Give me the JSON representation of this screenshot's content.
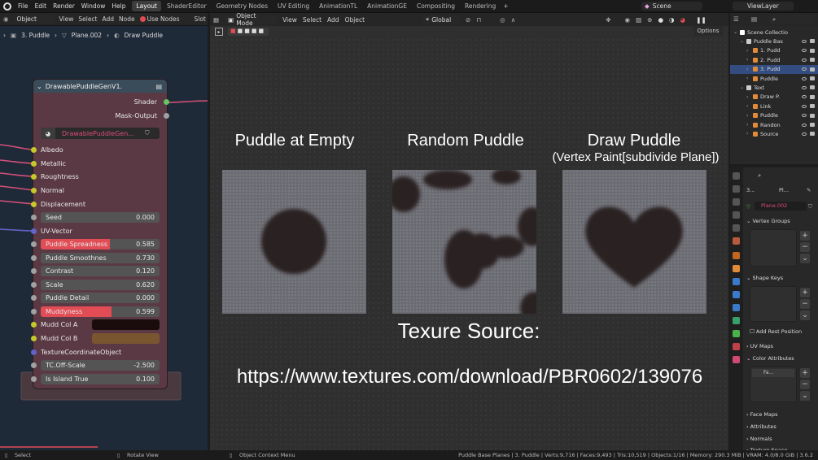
{
  "topbar": {
    "menus": [
      "File",
      "Edit",
      "Render",
      "Window",
      "Help"
    ],
    "workspaces": [
      "Layout",
      "ShaderEditor",
      "Geometry Nodes",
      "UV Editing",
      "AnimationTL",
      "AnimationGE",
      "Compositing",
      "Rendering"
    ],
    "active_workspace": "Layout",
    "scene": "Scene",
    "view_layer": "ViewLayer"
  },
  "node_header": {
    "mode": "Object",
    "menus": [
      "View",
      "Select",
      "Add",
      "Node"
    ],
    "use_nodes": "Use Nodes",
    "slot": "Slot"
  },
  "breadcrumb": [
    "3. Puddle",
    "Plane.002",
    "Draw Puddle"
  ],
  "node": {
    "title": "DrawablePuddleGenV1.",
    "outputs": [
      "Shader",
      "Mask-Output"
    ],
    "group_name": "DrawablePuddleGen...",
    "inputs": [
      "Albedo",
      "Metallic",
      "Roughtness",
      "Normal",
      "Displacement"
    ],
    "seed": {
      "label": "Seed",
      "value": "0.000"
    },
    "uv": "UV-Vector",
    "sliders": [
      {
        "label": "Puddle Spreadness",
        "value": "0.585",
        "fill": 0.585
      },
      {
        "label": "Puddle Smoothnes",
        "value": "0.730",
        "fill": 0
      },
      {
        "label": "Contrast",
        "value": "0.120",
        "fill": 0
      },
      {
        "label": "Scale",
        "value": "0.620",
        "fill": 0
      },
      {
        "label": "Puddle Detail",
        "value": "0.000",
        "fill": 0
      },
      {
        "label": "Muddyness",
        "value": "0.599",
        "fill": 0.599
      }
    ],
    "color_a": {
      "label": "Mudd Col A",
      "color": "#1a0c0c"
    },
    "color_b": {
      "label": "Mudd Col B",
      "color": "#7a5630"
    },
    "texcoord": "TextureCoordinateObject",
    "tc_offscale": {
      "label": "TC.Off-Scale",
      "value": "-2.500"
    },
    "island": {
      "label": "Is Island True",
      "value": "0.100"
    }
  },
  "viewport_header": {
    "mode": "Object Mode",
    "menus": [
      "View",
      "Select",
      "Add",
      "Object"
    ],
    "orientation": "Global",
    "options": "Options"
  },
  "captions": {
    "empty": "Puddle at Empty",
    "random": "Random Puddle",
    "draw": "Draw Puddle",
    "draw_sub": "(Vertex Paint[subdivide Plane])",
    "source_label": "Texure Source:",
    "url": "https://www.textures.com/download/PBR0602/139076"
  },
  "outliner": {
    "rows": [
      {
        "label": "Scene Collectio",
        "indent": 0,
        "color": "#ffffff",
        "sel": false
      },
      {
        "label": "Puddle Bas",
        "indent": 1,
        "color": "#cccccc",
        "sel": false
      },
      {
        "label": "1. Pudd",
        "indent": 2,
        "color": "#e08a3a",
        "sel": false
      },
      {
        "label": "2. Pudd",
        "indent": 2,
        "color": "#e08a3a",
        "sel": false
      },
      {
        "label": "3. Pudd",
        "indent": 2,
        "color": "#e08a3a",
        "sel": true
      },
      {
        "label": "Puddle",
        "indent": 2,
        "color": "#e08a3a",
        "sel": false
      },
      {
        "label": "Text",
        "indent": 1,
        "color": "#cccccc",
        "sel": false
      },
      {
        "label": "Draw P.",
        "indent": 2,
        "color": "#e08a3a",
        "sel": false
      },
      {
        "label": "Link",
        "indent": 2,
        "color": "#e08a3a",
        "sel": false
      },
      {
        "label": "Puddle",
        "indent": 2,
        "color": "#e08a3a",
        "sel": false
      },
      {
        "label": "Randon",
        "indent": 2,
        "color": "#e08a3a",
        "sel": false
      },
      {
        "label": "Source",
        "indent": 2,
        "color": "#e08a3a",
        "sel": false
      }
    ]
  },
  "properties": {
    "breadcrumb_a": "3...",
    "breadcrumb_b": "Pl...",
    "mesh_name": "Plane.002",
    "vertex_groups": "Vertex Groups",
    "shape_keys": "Shape Keys",
    "add_rest": "Add Rest Position",
    "uv_maps": "UV Maps",
    "color_attributes": "Color Attributes",
    "color_attr_item": "Fa...",
    "face_maps": "Face Maps",
    "attributes": "Attributes",
    "normals": "Normals",
    "texture_space": "Texture Space"
  },
  "status": {
    "select": "Select",
    "rotate": "Rotate View",
    "context": "Object Context Menu",
    "stats": "Puddle Base Planes | 3. Puddle | Verts:9,716 | Faces:9,493 | Tris:10,519 | Objects:1/16 | Memory: 290.3 MiB | VRAM: 4.0/8.0 GiB | 3.6.2"
  }
}
